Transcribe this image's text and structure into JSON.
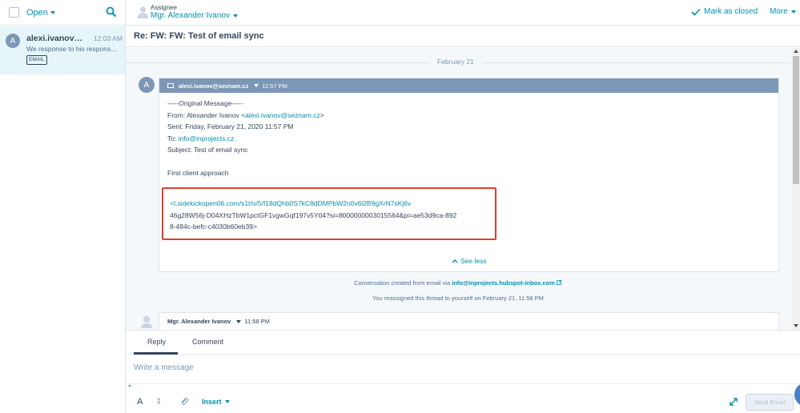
{
  "sidebar": {
    "filter_label": "Open",
    "conversation": {
      "avatar_initial": "A",
      "from": "alexi.ivanov@sezn...",
      "time": "12:03 AM",
      "snippet": "We response to his response and ...",
      "badge": "EMAIL"
    }
  },
  "header": {
    "assignee_label": "Assignee",
    "assignee_name": "Mgr. Alexander Ivanov",
    "mark_closed_label": "Mark as closed",
    "more_label": "More"
  },
  "subject": "Re: FW: FW: Test of email sync",
  "thread": {
    "date_divider": "February 21",
    "message": {
      "avatar_initial": "A",
      "sender": "alexi.ivanov@seznam.cz",
      "time": "11:57 PM",
      "lines": {
        "original": "-----Original Message-----",
        "from_prefix": "From: Alexander Ivanov <",
        "from_email": "alexi.ivanov@seznam.cz",
        "from_suffix": ">",
        "sent": "Sent: Friday, February 21, 2020 11:57 PM",
        "to_prefix": "To: ",
        "to_email": "info@inprojects.cz",
        "subject": "Subject: Test of email sync",
        "body": "First client approach"
      },
      "highlight": {
        "link": "<t.sidekickopen06.com/s1t/o/5/f18dQhb0S7kC8dDMPbW2n0x6l2B9gXrN7sKj6v",
        "line2": "46g28W56j-D04XHzTbW1pctGF1vgwGqf197v5Y04?si=8000000003015564&pi=ae53d9ca-892",
        "line3": "8-484c-befc-c4030b60eb39>"
      },
      "see_less": "See less"
    },
    "meta_created_prefix": "Conversation created from email via ",
    "meta_created_link": "info@inprojects.hubspot-inbox.com",
    "meta_reassigned": "You reassigned this thread to yourself on February 21, 11:58 PM",
    "message2": {
      "sender": "Mgr. Alexander Ivanov",
      "time": "11:58 PM"
    }
  },
  "composer": {
    "tabs": [
      "Reply",
      "Comment"
    ],
    "placeholder": "Write a message",
    "font_button": "A",
    "insert_label": "Insert",
    "send_label": "Send Email"
  },
  "colors": {
    "accent": "#0091ae",
    "header_bar": "#7c98b6",
    "highlight_border": "#e03c31",
    "selected_row": "#e5f5f8"
  }
}
